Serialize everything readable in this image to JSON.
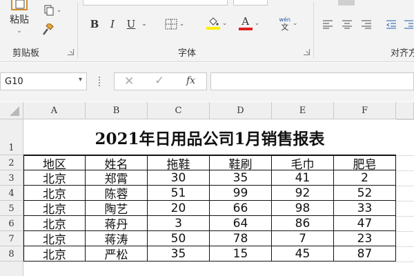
{
  "ribbon": {
    "clipboard": {
      "paste_label": "粘贴",
      "group_label": "剪贴板"
    },
    "font": {
      "group_label": "字体",
      "bold": "B",
      "italic": "I",
      "underline": "U",
      "phonetic_top": "wén",
      "phonetic_bottom": "文"
    },
    "alignment": {
      "group_label": "对齐方"
    },
    "colors": {
      "highlight": "#ffee00",
      "font_color": "#e02020"
    }
  },
  "formula_bar": {
    "name_box": "G10",
    "fx": "fx",
    "formula": ""
  },
  "sheet": {
    "columns": [
      "A",
      "B",
      "C",
      "D",
      "E",
      "F"
    ],
    "row_numbers": [
      "1",
      "2",
      "3",
      "4",
      "5",
      "6",
      "7",
      "8"
    ],
    "title": "2021年日用品公司1月销售报表",
    "headers": [
      "地区",
      "姓名",
      "拖鞋",
      "鞋刷",
      "毛巾",
      "肥皂"
    ],
    "rows": [
      [
        "北京",
        "郑霄",
        "30",
        "35",
        "41",
        "2"
      ],
      [
        "北京",
        "陈蓉",
        "51",
        "99",
        "92",
        "52"
      ],
      [
        "北京",
        "陶艺",
        "20",
        "66",
        "98",
        "33"
      ],
      [
        "北京",
        "蒋丹",
        "3",
        "64",
        "86",
        "47"
      ],
      [
        "北京",
        "蒋涛",
        "50",
        "78",
        "7",
        "23"
      ],
      [
        "北京",
        "严松",
        "35",
        "15",
        "45",
        "87"
      ]
    ]
  }
}
